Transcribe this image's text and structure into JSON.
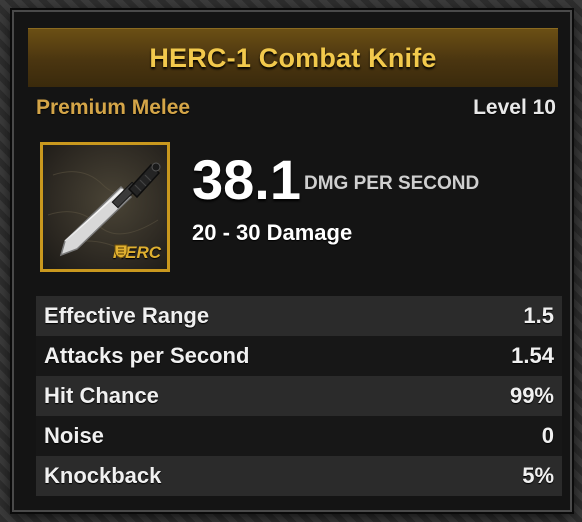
{
  "item": {
    "name": "HERC-1 Combat Knife",
    "class": "Premium Melee",
    "level": "Level 10",
    "brand": "HERC",
    "dps": "38.1",
    "dps_label": "DMG PER SECOND",
    "damage_range": "20 - 30 Damage"
  },
  "stats": [
    {
      "label": "Effective Range",
      "value": "1.5"
    },
    {
      "label": "Attacks per Second",
      "value": "1.54"
    },
    {
      "label": "Hit Chance",
      "value": "99%"
    },
    {
      "label": "Noise",
      "value": "0"
    },
    {
      "label": "Knockback",
      "value": "5%"
    }
  ],
  "icons": {
    "weapon": "combat-knife-icon",
    "brand": "herc-shield-icon"
  },
  "colors": {
    "title": "#f2c94c",
    "item_class": "#d4a548",
    "frame": "#c9981e"
  }
}
